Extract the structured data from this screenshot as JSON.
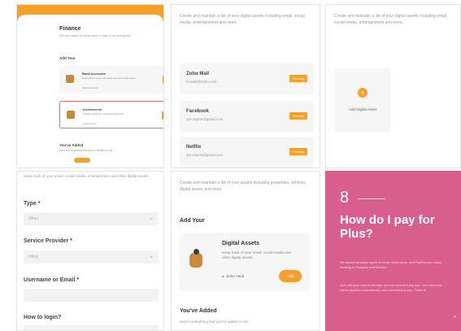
{
  "tile1": {
    "title": "Finance",
    "description": "Are your digital accounts ready in case of an emergency?",
    "subheading": "Add Your",
    "cards": [
      {
        "title": "Bank Accounts",
        "description": "Keep track of your accounts here and share them.",
        "meta": "Bank accounts"
      },
      {
        "title": "Investments",
        "description": "Stocks, bonds & investment accounts",
        "meta": "Investments"
      }
    ],
    "added_heading": "You've Added",
    "added_text": "Here's everything that you've added so far."
  },
  "tile2": {
    "intro": "Create and maintain a list of your digital assets including email, social media, entertainment and more.",
    "accounts": [
      {
        "name": "Zoho Mail",
        "email": "kunald@zoho.com",
        "badge": "Primary"
      },
      {
        "name": "Facebook",
        "email": "rjm.sisyne@gmail.com",
        "badge": "Primary"
      },
      {
        "name": "Netflix",
        "email": "rjm.sisyne@gmail.com",
        "badge": "Primary"
      }
    ]
  },
  "tile3": {
    "intro": "Create and maintain a list of your digital assets including email, social media, entertainment and more.",
    "add_label": "Add Digital Asset",
    "plus_glyph": "+"
  },
  "tile4": {
    "intro": "Keep track of your email, social media, entertainment and other digital assets.",
    "fields": [
      {
        "label": "Type *",
        "value": "Other",
        "has_chevron": true
      },
      {
        "label": "Service Provider *",
        "value": "Other",
        "has_chevron": true
      },
      {
        "label": "Username or Email *",
        "value": "",
        "has_chevron": false
      },
      {
        "label": "How to login?",
        "value": "",
        "has_chevron": false
      }
    ],
    "chevron_glyph": "⌄"
  },
  "tile5": {
    "intro": "Create and maintain a list of your assets including properties, vehicles, digital assets and more.",
    "subheading": "Add Your",
    "card": {
      "title": "Digital Assets",
      "description": "Keep track of your email, social media and other digital assets.",
      "meta": "Zoho Vault",
      "button": "Add"
    },
    "added_heading": "You've Added",
    "added_text": "Here's everything that you've added so far."
  },
  "tile6": {
    "number": "8",
    "question": "How do I pay for Plus?",
    "paragraph1": "We accept all major types of credit, debit cards, and PayPal and online banking in Malaysia and Mexico.",
    "paragraph2": "Just add your card to the sign up form and we'll pay you. Your discount will be applied automatically and processed to you. That's it!",
    "arrow": "»",
    "background": "#d85e8c"
  },
  "colors": {
    "accent": "#f5a02a",
    "highlight_border": "#ec6c6c"
  }
}
